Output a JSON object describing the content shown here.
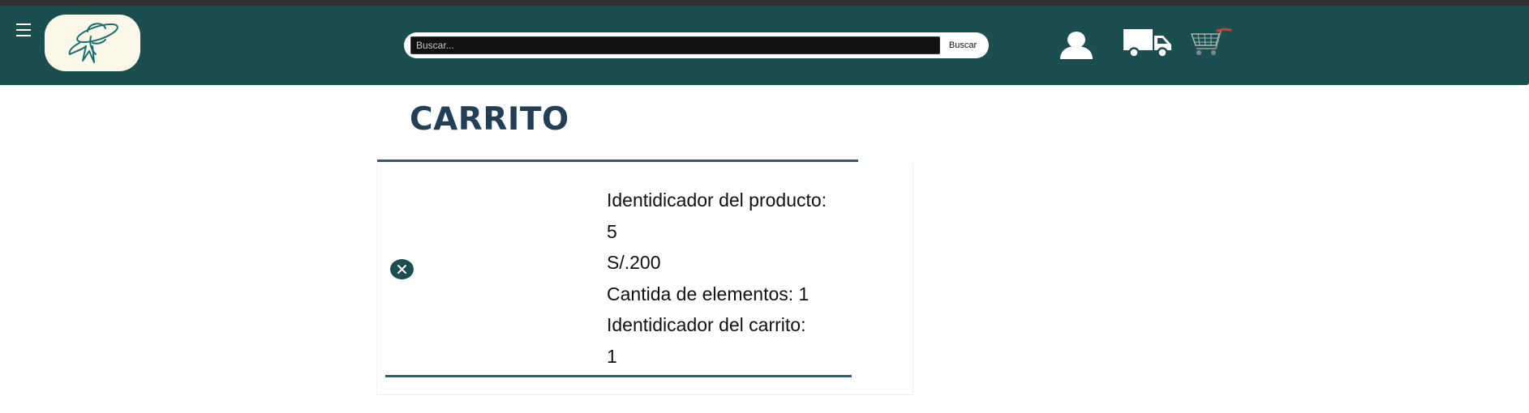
{
  "header": {
    "menu_icon": "hamburger-menu-icon",
    "logo_icon": "woman-sun-hat-icon",
    "search": {
      "placeholder": "Buscar...",
      "value": "",
      "button_label": "Buscar"
    },
    "icons": [
      "user-icon",
      "delivery-truck-icon",
      "shopping-cart-icon"
    ],
    "colors": {
      "navbar": "#1b4f4f",
      "logo_bg": "#fbf8ea",
      "cart_accent": "#d63a2f"
    }
  },
  "page": {
    "title": "CARRITO"
  },
  "cart": {
    "items": [
      {
        "product_id_label": "Identidicador del producto:",
        "product_id": "5",
        "price": "S/.200",
        "quantity_label": "Cantida de elementos: 1",
        "cart_id_label": "Identidicador del carrito:",
        "cart_id": "1",
        "remove_icon": "close-icon"
      }
    ]
  },
  "colors": {
    "title": "#233f55",
    "rule": "#2a6070"
  }
}
